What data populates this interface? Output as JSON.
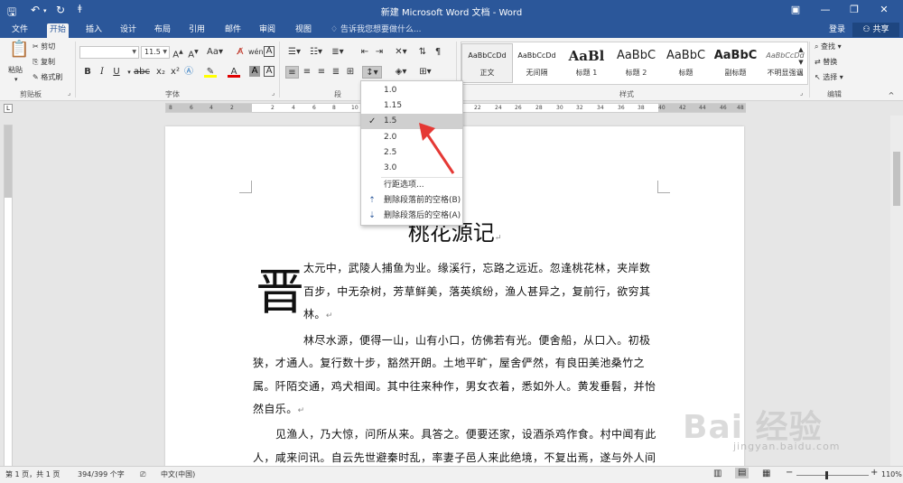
{
  "window": {
    "title": "新建 Microsoft Word 文档 - Word"
  },
  "tabs": [
    "文件",
    "开始",
    "插入",
    "设计",
    "布局",
    "引用",
    "邮件",
    "审阅",
    "视图"
  ],
  "tell_me": "告诉我您想要做什么...",
  "account": {
    "login": "登录",
    "share": "共享"
  },
  "clipboard": {
    "paste": "粘贴",
    "cut": "剪切",
    "copy": "复制",
    "format_painter": "格式刷",
    "label": "剪贴板"
  },
  "font": {
    "size": "11.5",
    "label": "字体"
  },
  "paragraph": {
    "label": "段"
  },
  "styles": {
    "label": "样式",
    "items": [
      {
        "sample": "AaBbCcDd",
        "name": "正文"
      },
      {
        "sample": "AaBbCcDd",
        "name": "无间隔"
      },
      {
        "sample": "AaBl",
        "name": "标题 1"
      },
      {
        "sample": "AaBbC",
        "name": "标题 2"
      },
      {
        "sample": "AaBbC",
        "name": "标题"
      },
      {
        "sample": "AaBbC",
        "name": "副标题"
      },
      {
        "sample": "AaBbCcDd",
        "name": "不明显强调"
      }
    ]
  },
  "editing": {
    "find": "查找",
    "replace": "替换",
    "select": "选择",
    "label": "编辑"
  },
  "ruler_ticks": [
    "8",
    "6",
    "4",
    "2",
    "2",
    "4",
    "6",
    "8",
    "10",
    "22",
    "24",
    "26",
    "28",
    "30",
    "32",
    "34",
    "36",
    "38",
    "40",
    "42",
    "44",
    "46",
    "48"
  ],
  "line_spacing_menu": {
    "options": [
      "1.0",
      "1.15",
      "1.5",
      "2.0",
      "2.5",
      "3.0"
    ],
    "selected": "1.5",
    "more": "行距选项...",
    "remove_before": "删除段落前的空格(B)",
    "remove_after": "删除段落后的空格(A)"
  },
  "document": {
    "title": "桃花源记",
    "dropcap": "晋",
    "p1": [
      "太元中，武陵人捕鱼为业。缘溪行，忘路之远近。忽逢桃花林，夹岸数",
      "百步，中无杂树，芳草鲜美，落英缤纷，渔人甚异之，复前行，欲穷其",
      "林。"
    ],
    "p2": [
      "林尽水源，便得一山，山有小口，仿佛若有光。便舍船，从口入。初极",
      "狭，才通人。复行数十步，豁然开朗。土地平旷，屋舍俨然，有良田美池桑竹之",
      "属。阡陌交通，鸡犬相闻。其中往来种作，男女衣着，悉如外人。黄发垂髫，并怡",
      "然自乐。"
    ],
    "p3": [
      "见渔人，乃大惊，问所从来。具答之。便要还家，设酒杀鸡作食。村中闻有此",
      "人，咸来问讯。自云先世避秦时乱，率妻子邑人来此绝境，不复出焉，遂与外人间"
    ]
  },
  "statusbar": {
    "page": "第 1 页，共 1 页",
    "words": "394/399 个字",
    "language": "中文(中国)",
    "zoom": "110%"
  },
  "watermark": {
    "text": "Bai 经验",
    "sub": "jingyan.baidu.com"
  }
}
